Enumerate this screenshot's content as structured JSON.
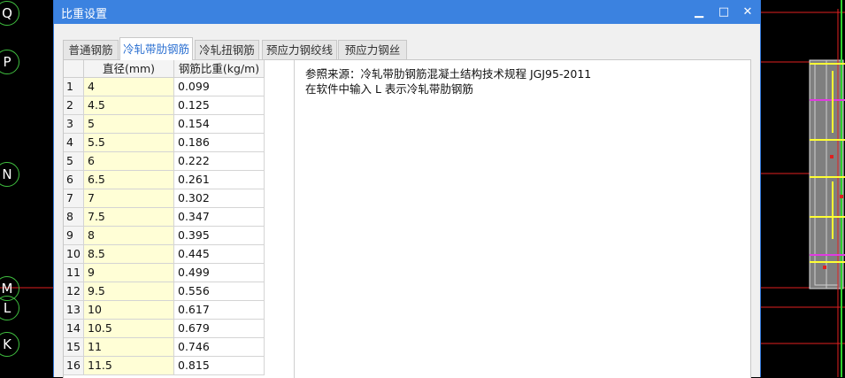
{
  "cad": {
    "axis_labels": [
      "Q",
      "P",
      "N",
      "M",
      "L",
      "K"
    ]
  },
  "dialog": {
    "title": "比重设置",
    "minimize_glyph": "▁",
    "maximize_glyph": "□",
    "close_glyph": "✕",
    "tabs": [
      "普通钢筋",
      "冷轧带肋钢筋",
      "冷轧扭钢筋",
      "预应力钢绞线",
      "预应力钢丝"
    ],
    "active_tab": "冷轧带肋钢筋",
    "table": {
      "columns": [
        "",
        "直径(mm)",
        "钢筋比重(kg/m)"
      ],
      "rows": [
        [
          "1",
          "4",
          "0.099"
        ],
        [
          "2",
          "4.5",
          "0.125"
        ],
        [
          "3",
          "5",
          "0.154"
        ],
        [
          "4",
          "5.5",
          "0.186"
        ],
        [
          "5",
          "6",
          "0.222"
        ],
        [
          "6",
          "6.5",
          "0.261"
        ],
        [
          "7",
          "7",
          "0.302"
        ],
        [
          "8",
          "7.5",
          "0.347"
        ],
        [
          "9",
          "8",
          "0.395"
        ],
        [
          "10",
          "8.5",
          "0.445"
        ],
        [
          "11",
          "9",
          "0.499"
        ],
        [
          "12",
          "9.5",
          "0.556"
        ],
        [
          "13",
          "10",
          "0.617"
        ],
        [
          "14",
          "10.5",
          "0.679"
        ],
        [
          "15",
          "11",
          "0.746"
        ],
        [
          "16",
          "11.5",
          "0.815"
        ]
      ]
    },
    "notes": {
      "line1": "参照来源：冷轧带肋钢筋混凝土结构技术规程 JGJ95-2011",
      "line2": "在软件中输入 L 表示冷轧带肋钢筋"
    }
  },
  "colors": {
    "title_bar": "#3b82e0",
    "diameter_column_bg": "#fffed6",
    "active_tab_text": "#2a6fd1",
    "cad_background": "#000000",
    "cad_axis_line": "#e02020",
    "cad_axis_bubble": "#3fbf3f"
  }
}
